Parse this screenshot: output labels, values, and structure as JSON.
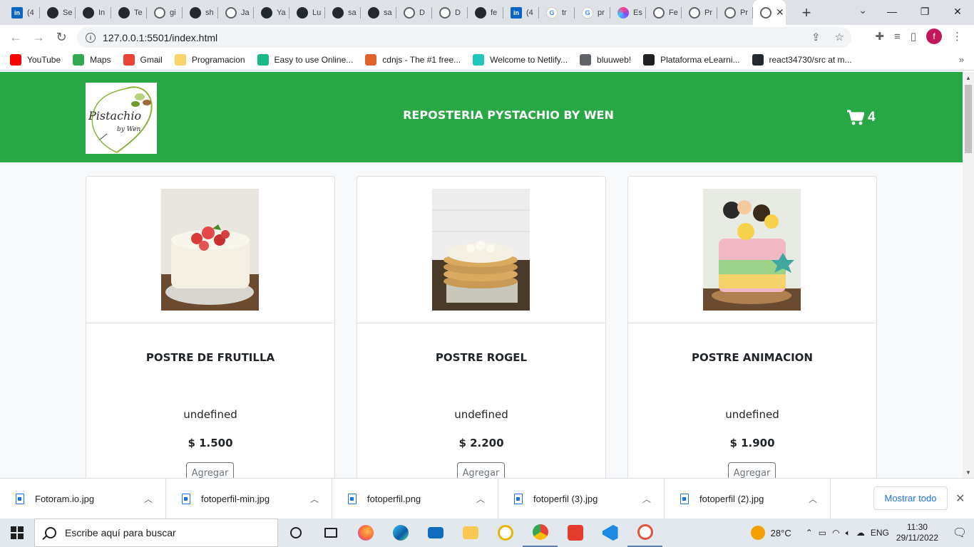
{
  "browser": {
    "tabs": [
      {
        "icon": "linkedin-icon",
        "label": "(4"
      },
      {
        "icon": "github-icon",
        "label": "Se"
      },
      {
        "icon": "github-icon",
        "label": "In"
      },
      {
        "icon": "github-icon",
        "label": "Te"
      },
      {
        "icon": "globe-icon",
        "label": "gi"
      },
      {
        "icon": "github-icon",
        "label": "sh"
      },
      {
        "icon": "globe-icon",
        "label": "Ja"
      },
      {
        "icon": "github-icon",
        "label": "Ya"
      },
      {
        "icon": "github-icon",
        "label": "Lu"
      },
      {
        "icon": "github-icon",
        "label": "sa"
      },
      {
        "icon": "github-icon",
        "label": "sa"
      },
      {
        "icon": "globe-icon",
        "label": "D"
      },
      {
        "icon": "globe-icon",
        "label": "D"
      },
      {
        "icon": "github-icon",
        "label": "fe"
      },
      {
        "icon": "linkedin-icon",
        "label": "(4"
      },
      {
        "icon": "google-icon",
        "label": "tr"
      },
      {
        "icon": "google-icon",
        "label": "pr"
      },
      {
        "icon": "ring-icon",
        "label": "Es"
      },
      {
        "icon": "globe-icon",
        "label": "Fe"
      },
      {
        "icon": "globe-icon",
        "label": "Pr"
      },
      {
        "icon": "globe-icon",
        "label": "Pr"
      }
    ],
    "active_tab_close": "✕",
    "new_tab": "+",
    "url": "127.0.0.1:5501/index.html",
    "bookmarks": [
      {
        "label": "YouTube",
        "icon": "youtube-icon",
        "color": "#ff0000"
      },
      {
        "label": "Maps",
        "icon": "maps-icon",
        "color": "#34a853"
      },
      {
        "label": "Gmail",
        "icon": "gmail-icon",
        "color": "#ea4335"
      },
      {
        "label": "Programacion",
        "icon": "folder-icon",
        "color": "#f9d66b"
      },
      {
        "label": "Easy to use Online...",
        "icon": "s-icon",
        "color": "#18b887"
      },
      {
        "label": "cdnjs - The #1 free...",
        "icon": "code-icon",
        "color": "#e2602c"
      },
      {
        "label": "Welcome to Netlify...",
        "icon": "netlify-icon",
        "color": "#20c6b7"
      },
      {
        "label": "bluuweb!",
        "icon": "globe-icon",
        "color": "#5f6368"
      },
      {
        "label": "Plataforma eLearni...",
        "icon": "elearning-icon",
        "color": "#202124"
      },
      {
        "label": "react34730/src at m...",
        "icon": "github-icon",
        "color": "#24292f"
      }
    ],
    "profile_initial": "f"
  },
  "site": {
    "title": "REPOSTERIA PYSTACHIO BY WEN",
    "logo_text_1": "Pistachio",
    "logo_text_2": "by Wen",
    "cart_count": "4",
    "accent": "#28a745",
    "products": [
      {
        "name": "POSTRE DE FRUTILLA",
        "desc": "undefined",
        "price": "$ 1.500",
        "button": "Agregar"
      },
      {
        "name": "POSTRE ROGEL",
        "desc": "undefined",
        "price": "$ 2.200",
        "button": "Agregar"
      },
      {
        "name": "POSTRE ANIMACION",
        "desc": "undefined",
        "price": "$ 1.900",
        "button": "Agregar"
      }
    ]
  },
  "downloads": {
    "items": [
      "Fotoram.io.jpg",
      "fotoperfil-min.jpg",
      "fotoperfil.png",
      "fotoperfil (3).jpg",
      "fotoperfil (2).jpg"
    ],
    "show_all": "Mostrar todo"
  },
  "taskbar": {
    "search_placeholder": "Escribe aquí para buscar",
    "temperature": "28°C",
    "language": "ENG",
    "time": "11:30",
    "date": "29/11/2022"
  }
}
